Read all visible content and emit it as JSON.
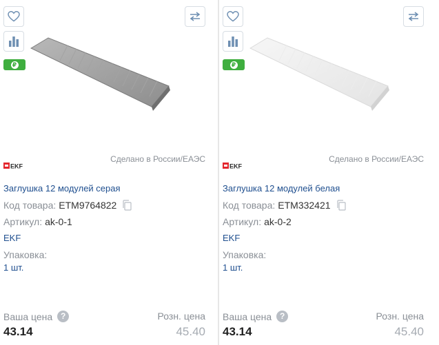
{
  "products": [
    {
      "title": "Заглушка 12 модулей серая",
      "code_label": "Код товара:",
      "code": "ETM9764822",
      "article_label": "Артикул:",
      "article": "ak-0-1",
      "brand": "EKF",
      "packaging_label": "Упаковка:",
      "packaging": "1 шт.",
      "made_in": "Сделано в России/ЕАЭС",
      "your_price_label": "Ваша цена",
      "your_price": "43.14",
      "retail_label": "Розн. цена",
      "retail_price": "45.40",
      "image_color": "gray",
      "logo_text": "EKF"
    },
    {
      "title": "Заглушка 12 модулей белая",
      "code_label": "Код товара:",
      "code": "ETM332421",
      "article_label": "Артикул:",
      "article": "ak-0-2",
      "brand": "EKF",
      "packaging_label": "Упаковка:",
      "packaging": "1 шт.",
      "made_in": "Сделано в России/ЕАЭС",
      "your_price_label": "Ваша цена",
      "your_price": "43.14",
      "retail_label": "Розн. цена",
      "retail_price": "45.40",
      "image_color": "white",
      "logo_text": "EKF"
    }
  ],
  "icons": {
    "favorite": "heart-icon",
    "compare": "bar-chart-icon",
    "swap": "swap-arrows-icon",
    "ruble": "ruble-icon",
    "copy": "copy-icon",
    "help": "help-icon"
  },
  "colors": {
    "link": "#1f4f8f",
    "badge_green": "#3fae3f",
    "icon_blue": "#6e8fb2"
  }
}
